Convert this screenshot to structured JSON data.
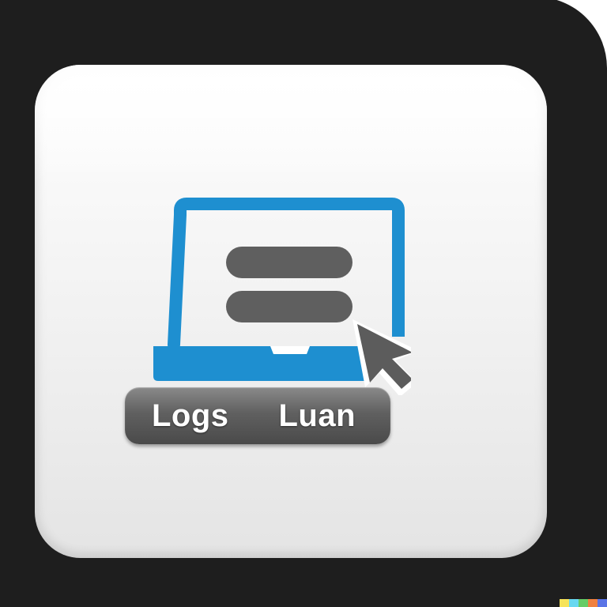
{
  "button": {
    "left_label": "Logs",
    "right_label": "Luan"
  },
  "icons": {
    "laptop": "laptop-icon",
    "menu": "menu-lines-icon",
    "cursor": "mouse-cursor-icon"
  },
  "colors": {
    "frame": "#1e1e1e",
    "panel": "#f2f2f2",
    "laptop_accent": "#1e8fd0",
    "menu_bar": "#5f5f5f",
    "cursor": "#5c5c5c",
    "button": "#5e5e5e",
    "button_text": "#ffffff"
  }
}
